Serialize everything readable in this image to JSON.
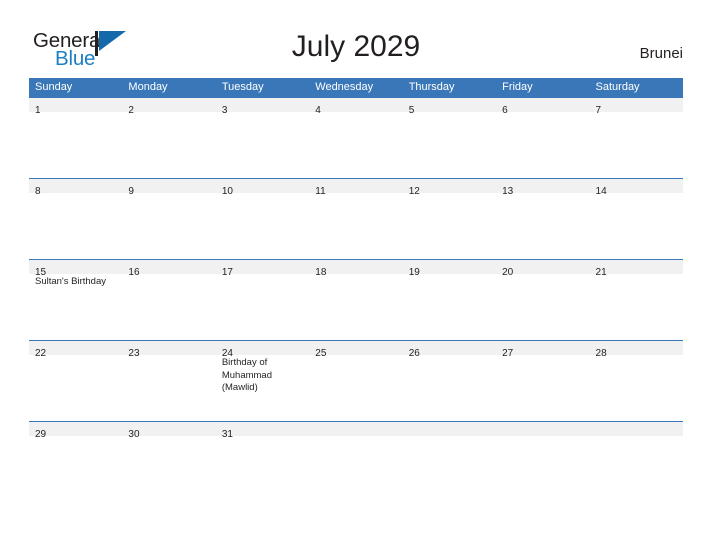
{
  "brand": {
    "name_part1": "General",
    "name_part2": "Blue",
    "mark_icon": "flag-triangle-icon"
  },
  "header": {
    "title": "July 2029",
    "country": "Brunei"
  },
  "calendar": {
    "weekdays": [
      "Sunday",
      "Monday",
      "Tuesday",
      "Wednesday",
      "Thursday",
      "Friday",
      "Saturday"
    ],
    "header_color": "#3a77b8",
    "band_color": "#f1f1f1",
    "weeks": [
      {
        "days": [
          {
            "num": "1",
            "events": []
          },
          {
            "num": "2",
            "events": []
          },
          {
            "num": "3",
            "events": []
          },
          {
            "num": "4",
            "events": []
          },
          {
            "num": "5",
            "events": []
          },
          {
            "num": "6",
            "events": []
          },
          {
            "num": "7",
            "events": []
          }
        ]
      },
      {
        "days": [
          {
            "num": "8",
            "events": []
          },
          {
            "num": "9",
            "events": []
          },
          {
            "num": "10",
            "events": []
          },
          {
            "num": "11",
            "events": []
          },
          {
            "num": "12",
            "events": []
          },
          {
            "num": "13",
            "events": []
          },
          {
            "num": "14",
            "events": []
          }
        ]
      },
      {
        "days": [
          {
            "num": "15",
            "events": [
              "Sultan's Birthday"
            ]
          },
          {
            "num": "16",
            "events": []
          },
          {
            "num": "17",
            "events": []
          },
          {
            "num": "18",
            "events": []
          },
          {
            "num": "19",
            "events": []
          },
          {
            "num": "20",
            "events": []
          },
          {
            "num": "21",
            "events": []
          }
        ]
      },
      {
        "days": [
          {
            "num": "22",
            "events": []
          },
          {
            "num": "23",
            "events": []
          },
          {
            "num": "24",
            "events": [
              "Birthday of Muhammad (Mawlid)"
            ]
          },
          {
            "num": "25",
            "events": []
          },
          {
            "num": "26",
            "events": []
          },
          {
            "num": "27",
            "events": []
          },
          {
            "num": "28",
            "events": []
          }
        ]
      },
      {
        "days": [
          {
            "num": "29",
            "events": []
          },
          {
            "num": "30",
            "events": []
          },
          {
            "num": "31",
            "events": []
          },
          {
            "num": "",
            "events": []
          },
          {
            "num": "",
            "events": []
          },
          {
            "num": "",
            "events": []
          },
          {
            "num": "",
            "events": []
          }
        ]
      }
    ]
  }
}
